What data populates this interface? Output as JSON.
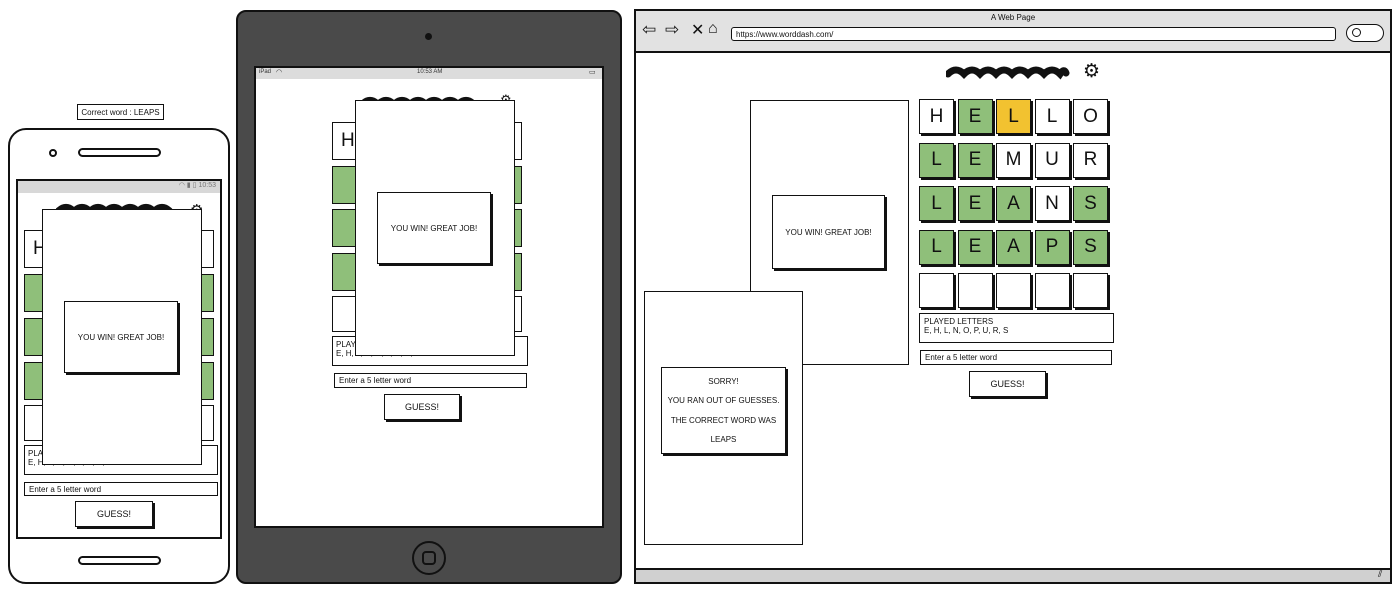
{
  "note": "Correct word : LEAPS",
  "modal": {
    "win": "YOU WIN! GREAT JOB!"
  },
  "lose": [
    "SORRY!",
    "YOU RAN OUT OF GUESSES.",
    "THE CORRECT WORD WAS",
    "LEAPS"
  ],
  "game": {
    "played_title": "PLAYED LETTERS",
    "played_letters": "E, H, L, N, O, P, U, R, S",
    "input_placeholder": "Enter a 5 letter word",
    "guess_label": "GUESS!"
  },
  "tablet": {
    "status_left": "iPad",
    "status_time": "10:53 AM"
  },
  "phone": {
    "status_time": "10:53"
  },
  "browser": {
    "title": "A Web Page",
    "url": "https://www.worddash.com/"
  },
  "grid": [
    [
      {
        "l": "H",
        "s": "white"
      },
      {
        "l": "E",
        "s": "green"
      },
      {
        "l": "L",
        "s": "yellow"
      },
      {
        "l": "L",
        "s": "white"
      },
      {
        "l": "O",
        "s": "white"
      }
    ],
    [
      {
        "l": "L",
        "s": "green"
      },
      {
        "l": "E",
        "s": "green"
      },
      {
        "l": "M",
        "s": "white"
      },
      {
        "l": "U",
        "s": "white"
      },
      {
        "l": "R",
        "s": "white"
      }
    ],
    [
      {
        "l": "L",
        "s": "green"
      },
      {
        "l": "E",
        "s": "green"
      },
      {
        "l": "A",
        "s": "green"
      },
      {
        "l": "N",
        "s": "white"
      },
      {
        "l": "S",
        "s": "green"
      }
    ],
    [
      {
        "l": "L",
        "s": "green"
      },
      {
        "l": "E",
        "s": "green"
      },
      {
        "l": "A",
        "s": "green"
      },
      {
        "l": "P",
        "s": "green"
      },
      {
        "l": "S",
        "s": "green"
      }
    ],
    [
      {
        "l": "",
        "s": "white"
      },
      {
        "l": "",
        "s": "white"
      },
      {
        "l": "",
        "s": "white"
      },
      {
        "l": "",
        "s": "white"
      },
      {
        "l": "",
        "s": "white"
      }
    ]
  ],
  "colors": {
    "green": "#8fbf7a",
    "yellow": "#f2c230",
    "tablet_frame": "#4a4a4a"
  }
}
